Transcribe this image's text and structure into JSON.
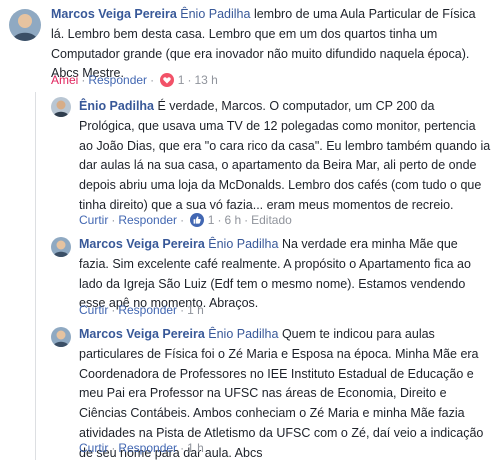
{
  "comments": [
    {
      "author": "Marcos Veiga Pereira",
      "mention": "Ênio Padilha",
      "text": " lembro de uma Aula Particular de Física lá. Lembro bem desta casa. Lembro que em um dos quartos tinha um Computador grande (que era inovador não muito difundido naquela época). Abcs Mestre.",
      "actions": {
        "like": "Amei",
        "reply": "Responder",
        "reaction_count": "1",
        "time": "13 h"
      }
    },
    {
      "author": "Ênio Padilha",
      "mention": "",
      "text": " É verdade, Marcos. O computador, um CP 200 da Prológica, que usava uma TV de 12 polegadas como monitor, pertencia ao João Dias, que era \"o cara rico da casa\". Eu lembro também quando ia dar aulas lá na sua casa, o apartamento da Beira Mar, ali perto de onde depois abriu uma loja da McDonalds. Lembro dos cafés (com tudo o que tinha direito) que a sua vó fazia... eram meus momentos de recreio.",
      "actions": {
        "like": "Curtir",
        "reply": "Responder",
        "reaction_count": "1",
        "time": "6 h",
        "edited": "Editado"
      }
    },
    {
      "author": "Marcos Veiga Pereira",
      "mention": "Ênio Padilha",
      "text": " Na verdade era minha Mãe que fazia. Sim excelente café realmente. A propósito o Apartamento fica ao lado da Igreja São Luiz (Edf tem o mesmo nome). Estamos vendendo esse apê no momento. Abraços.",
      "actions": {
        "like": "Curtir",
        "reply": "Responder",
        "time": "1 h"
      }
    },
    {
      "author": "Marcos Veiga Pereira",
      "mention": "Ênio Padilha",
      "text": " Quem te indicou para aulas particulares de Física foi o Zé Maria e Esposa na época. Minha Mãe era Coordenadora de Professores no IEE Instituto Estadual de Educação e meu Pai era Professor na UFSC nas áreas de Economia, Direito e Ciências Contábeis. Ambos conheciam o Zé Maria e minha Mãe fazia atividades na Pista de Atletismo da UFSC com o Zé, daí veio a indicação de seu nome para dar aula. Abcs",
      "actions": {
        "like": "Curtir",
        "reply": "Responder",
        "time": "1 h"
      }
    }
  ],
  "colors": {
    "link": "#385898",
    "action": "#4267b2",
    "meta": "#90949c",
    "love": "#e0245e",
    "like": "#4267b2"
  }
}
